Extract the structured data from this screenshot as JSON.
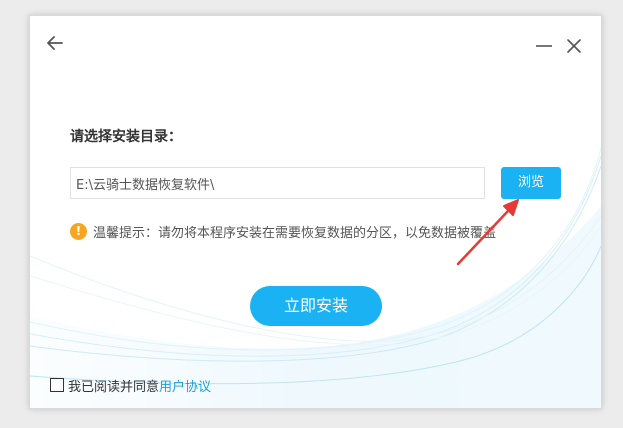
{
  "window": {
    "back_icon": "arrow-left-icon",
    "minimize_icon": "minimize-icon",
    "close_icon": "close-icon"
  },
  "install": {
    "dir_label": "请选择安装目录：",
    "path_value": "E:\\云骑士数据恢复软件\\",
    "browse_label": "浏览",
    "tip_icon": "info-icon",
    "tip_icon_glyph": "!",
    "tip_text": "温馨提示：请勿将本程序安装在需要恢复数据的分区，以免数据被覆盖",
    "install_label": "立即安装"
  },
  "agreement": {
    "checked": false,
    "text": "我已阅读并同意",
    "link": "用户协议"
  },
  "colors": {
    "accent": "#1ab2f3",
    "tip": "#f5a623",
    "arrow": "#e53935",
    "link": "#1a9fe0"
  }
}
